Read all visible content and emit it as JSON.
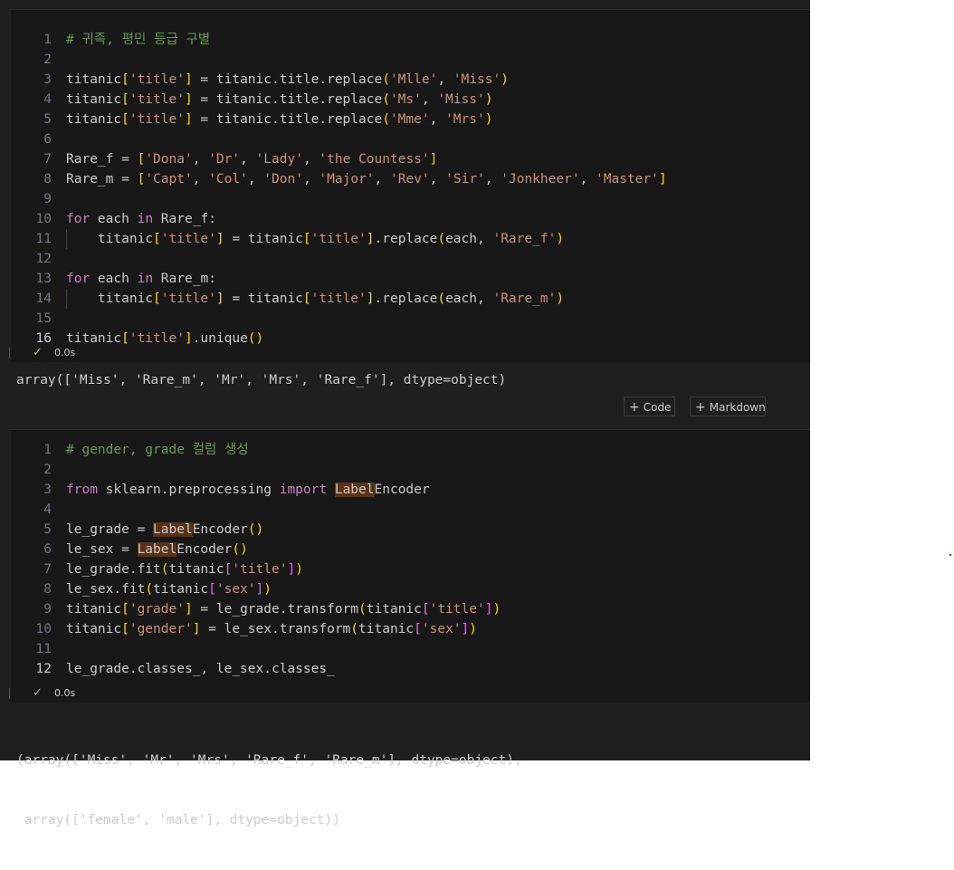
{
  "cell1": {
    "lines": [
      {
        "n": "1"
      },
      {
        "n": "2"
      },
      {
        "n": "3"
      },
      {
        "n": "4"
      },
      {
        "n": "5"
      },
      {
        "n": "6"
      },
      {
        "n": "7"
      },
      {
        "n": "8"
      },
      {
        "n": "9"
      },
      {
        "n": "10"
      },
      {
        "n": "11"
      },
      {
        "n": "12"
      },
      {
        "n": "13"
      },
      {
        "n": "14"
      },
      {
        "n": "15"
      },
      {
        "n": "16"
      }
    ],
    "comment": "# 귀족, 평민 등급 구별",
    "status_time": "0.0s",
    "output": "array(['Miss', 'Rare_m', 'Mr', 'Mrs', 'Rare_f'], dtype=object)"
  },
  "toolbar": {
    "code_label": "Code",
    "markdown_label": "Markdown"
  },
  "cell2": {
    "lines": [
      {
        "n": "1"
      },
      {
        "n": "2"
      },
      {
        "n": "3"
      },
      {
        "n": "4"
      },
      {
        "n": "5"
      },
      {
        "n": "6"
      },
      {
        "n": "7"
      },
      {
        "n": "8"
      },
      {
        "n": "9"
      },
      {
        "n": "10"
      },
      {
        "n": "11"
      },
      {
        "n": "12"
      }
    ],
    "comment": "# gender, grade 컬럼 생성",
    "status_time": "0.0s",
    "output_line1": "(array(['Miss', 'Mr', 'Mrs', 'Rare_f', 'Rare_m'], dtype=object),",
    "output_line2": " array(['female', 'male'], dtype=object))"
  },
  "colors": {
    "keyword": "#c586c0",
    "string": "#ce9178",
    "comment": "#6a9955",
    "bracket": "#ffd700",
    "highlight": "#5c3216",
    "success": "#89d185"
  },
  "icons": [
    "check-icon",
    "plus-icon"
  ]
}
